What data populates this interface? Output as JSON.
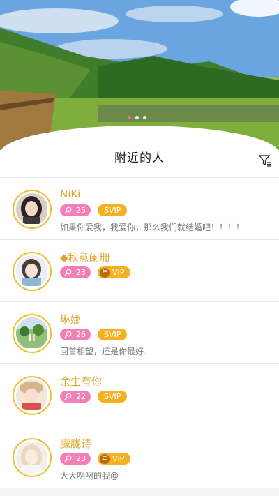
{
  "header": {
    "title": "附近的人"
  },
  "icons": {
    "filter": "filter-icon",
    "age": "search-icon"
  },
  "colors": {
    "name": "#e0a32a",
    "age_badge": "#f37fb4",
    "vip_badge": "#f5b122",
    "ring": "#f2bd2b",
    "title_underline": "#f06a6a"
  },
  "carousel": {
    "slides": 3,
    "active": 1
  },
  "users": [
    {
      "name": "NiKi",
      "age": "25",
      "vip": "SVIP",
      "vip_year": "",
      "sign": "如果你爱我，我爱你，那么我们就结婚吧！！！！"
    },
    {
      "name": "◆秋意阑珊",
      "age": "23",
      "vip": "VIP",
      "vip_year": "年",
      "sign": ""
    },
    {
      "name": "琳娜",
      "age": "26",
      "vip": "SVIP",
      "vip_year": "",
      "sign": "回首相望，还是你最好."
    },
    {
      "name": "余生有你",
      "age": "22",
      "vip": "SVIP",
      "vip_year": "",
      "sign": ""
    },
    {
      "name": "朦胧诗",
      "age": "23",
      "vip": "VIP",
      "vip_year": "年",
      "sign": "大大咧咧的我@"
    }
  ]
}
